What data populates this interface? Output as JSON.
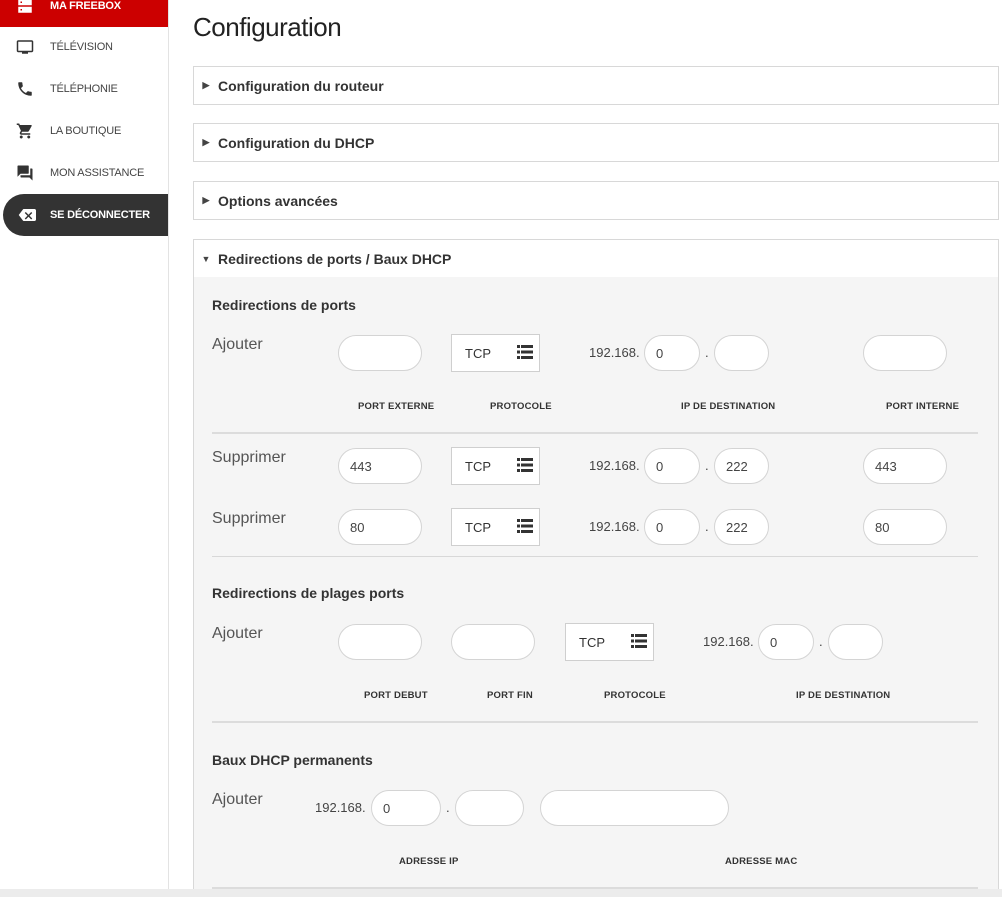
{
  "sidebar": {
    "items": [
      {
        "label": "MA FREEBOX",
        "icon": "server-icon"
      },
      {
        "label": "TÉLÉVISION",
        "icon": "tv-icon"
      },
      {
        "label": "TÉLÉPHONIE",
        "icon": "phone-icon"
      },
      {
        "label": "LA BOUTIQUE",
        "icon": "cart-icon"
      },
      {
        "label": "MON ASSISTANCE",
        "icon": "chat-icon"
      },
      {
        "label": "SE DÉCONNECTER",
        "icon": "logout-icon"
      }
    ]
  },
  "page": {
    "title": "Configuration"
  },
  "panels": [
    {
      "title": "Configuration du routeur",
      "expanded": false
    },
    {
      "title": "Configuration du DHCP",
      "expanded": false
    },
    {
      "title": "Options avancées",
      "expanded": false
    },
    {
      "title": "Redirections de ports / Baux DHCP",
      "expanded": true
    }
  ],
  "ports": {
    "title": "Redirections de ports",
    "add_label": "Ajouter",
    "add_row": {
      "port_externe": "",
      "protocole": "TCP",
      "ip_prefix": "192.168.",
      "ip_3": "0",
      "ip_4": "",
      "port_interne": ""
    },
    "columns": {
      "port_externe": "PORT EXTERNE",
      "protocole": "PROTOCOLE",
      "ip": "IP DE DESTINATION",
      "port_interne": "PORT INTERNE"
    },
    "rows": [
      {
        "action": "Supprimer",
        "port_externe": "443",
        "protocole": "TCP",
        "ip_prefix": "192.168.",
        "ip_3": "0",
        "ip_4": "222",
        "port_interne": "443"
      },
      {
        "action": "Supprimer",
        "port_externe": "80",
        "protocole": "TCP",
        "ip_prefix": "192.168.",
        "ip_3": "0",
        "ip_4": "222",
        "port_interne": "80"
      }
    ]
  },
  "ranges": {
    "title": "Redirections de plages ports",
    "add_label": "Ajouter",
    "add_row": {
      "port_debut": "",
      "port_fin": "",
      "protocole": "TCP",
      "ip_prefix": "192.168.",
      "ip_3": "0",
      "ip_4": ""
    },
    "columns": {
      "port_debut": "PORT DEBUT",
      "port_fin": "PORT FIN",
      "protocole": "PROTOCOLE",
      "ip": "IP DE DESTINATION"
    }
  },
  "dhcp": {
    "title": "Baux DHCP permanents",
    "add_label": "Ajouter",
    "add_row": {
      "ip_prefix": "192.168.",
      "ip_3": "0",
      "ip_4": "",
      "mac": ""
    },
    "columns": {
      "ip": "ADRESSE IP",
      "mac": "ADRESSE MAC"
    }
  },
  "ip_separator": ".",
  "colors": {
    "accent": "#cc0000",
    "logout_bg": "#333333",
    "panel_bg": "#f5f5f5"
  }
}
